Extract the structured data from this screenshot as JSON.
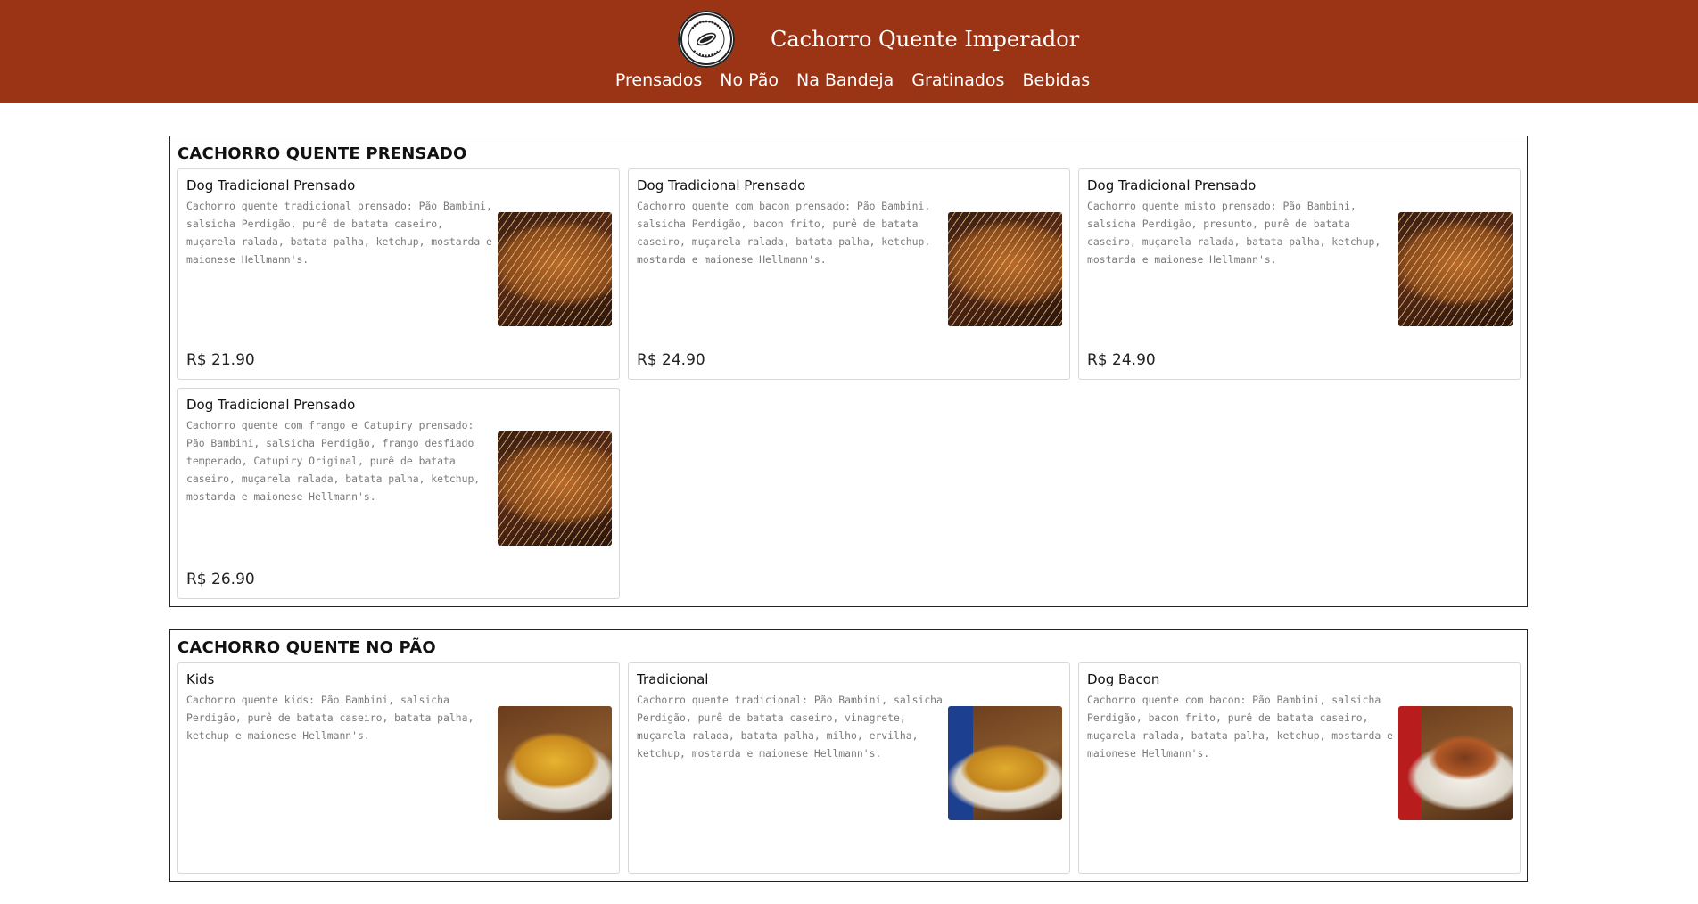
{
  "header": {
    "title": "Cachorro Quente Imperador",
    "logo_icon": "hotdog-seal-logo",
    "logo_text_top": "CACHORRO QUENTE",
    "logo_text_bottom": "IMPERADOR",
    "background": "#9b3315"
  },
  "nav": [
    {
      "label": "Prensados"
    },
    {
      "label": "No Pão"
    },
    {
      "label": "Na Bandeja"
    },
    {
      "label": "Gratinados"
    },
    {
      "label": "Bebidas"
    }
  ],
  "sections": [
    {
      "title": "CACHORRO QUENTE PRENSADO",
      "items": [
        {
          "name": "Dog Tradicional Prensado",
          "description": "Cachorro quente tradicional prensado: Pão Bambini, salsicha Perdigão, purê de batata caseiro, muçarela ralada, batata palha, ketchup, mostarda e maionese Hellmann's.",
          "price": "R$ 21.90",
          "image": "pressed-hotdog-photo"
        },
        {
          "name": "Dog Tradicional Prensado",
          "description": "Cachorro quente com bacon prensado: Pão Bambini, salsicha Perdigão, bacon frito, purê de batata caseiro, muçarela ralada, batata palha, ketchup, mostarda e maionese Hellmann's.",
          "price": "R$ 24.90",
          "image": "pressed-hotdog-photo"
        },
        {
          "name": "Dog Tradicional Prensado",
          "description": "Cachorro quente misto prensado: Pão Bambini, salsicha Perdigão, presunto, purê de batata caseiro, muçarela ralada, batata palha, ketchup, mostarda e maionese Hellmann's.",
          "price": "R$ 24.90",
          "image": "pressed-hotdog-photo"
        },
        {
          "name": "Dog Tradicional Prensado",
          "description": "Cachorro quente com frango e Catupiry prensado: Pão Bambini, salsicha Perdigão, frango desfiado temperado, Catupiry Original, purê de batata caseiro, muçarela ralada, batata palha, ketchup, mostarda e maionese Hellmann's.",
          "price": "R$ 26.90",
          "image": "pressed-hotdog-photo"
        }
      ]
    },
    {
      "title": "CACHORRO QUENTE NO PÃO",
      "items": [
        {
          "name": "Kids",
          "description": "Cachorro quente kids: Pão Bambini, salsicha Perdigão, purê de batata caseiro, batata palha, ketchup e maionese Hellmann's.",
          "price": "",
          "image": "hotdog-tray-photo"
        },
        {
          "name": "Tradicional",
          "description": "Cachorro quente tradicional: Pão Bambini, salsicha Perdigão, purê de batata caseiro, vinagrete, muçarela ralada, batata palha, milho, ervilha, ketchup, mostarda e maionese Hellmann's.",
          "price": "",
          "image": "hotdog-with-soda-photo"
        },
        {
          "name": "Dog Bacon",
          "description": "Cachorro quente com bacon: Pão Bambini, salsicha Perdigão, bacon frito, purê de batata caseiro, muçarela ralada, batata palha, ketchup, mostarda e maionese Hellmann's.",
          "price": "",
          "image": "bacon-hotdog-photo"
        }
      ]
    }
  ]
}
